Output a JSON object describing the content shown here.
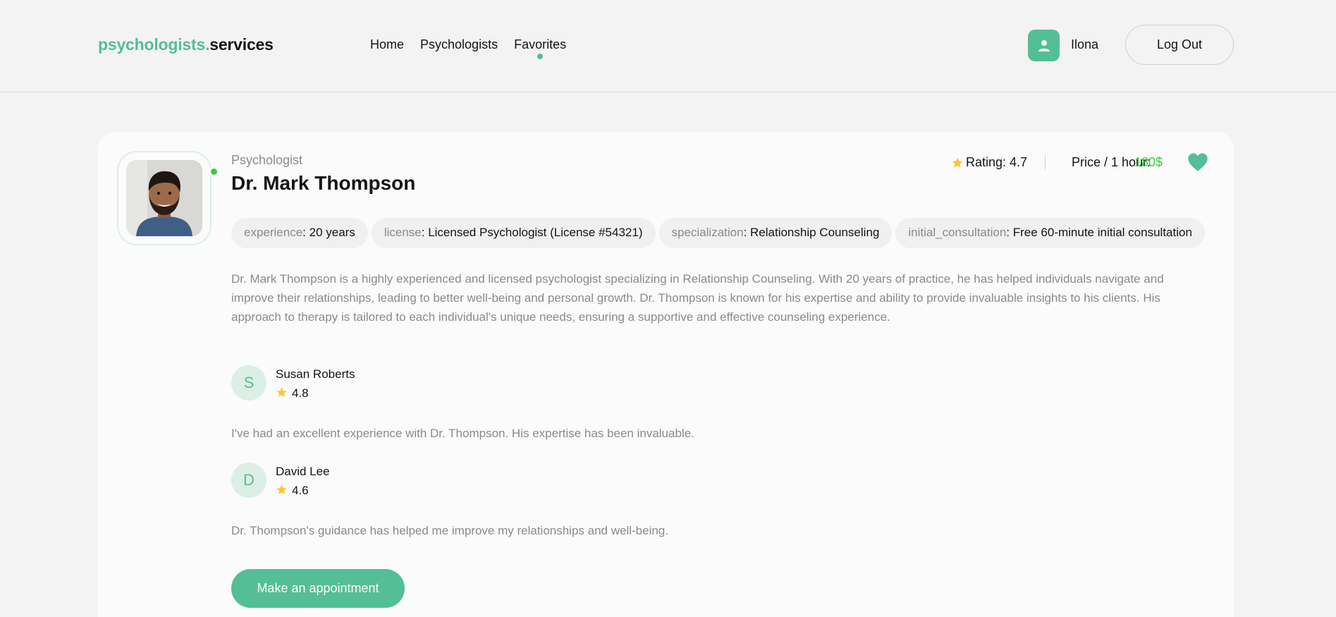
{
  "header": {
    "logo_accent": "psychologists.",
    "logo_rest": "services",
    "nav": [
      {
        "label": "Home",
        "active": false
      },
      {
        "label": "Psychologists",
        "active": false
      },
      {
        "label": "Favorites",
        "active": true
      }
    ],
    "user_icon": "user-icon",
    "user_name": "Ilona",
    "logout_label": "Log Out"
  },
  "profile": {
    "role": "Psychologist",
    "name": "Dr. Mark Thompson",
    "online": true,
    "rating_label": "Rating: 4.7",
    "price_label": "Price / 1 hour:",
    "price_value": "180$",
    "favorite": true,
    "tags": [
      {
        "key": "experience",
        "value": ": 20 years"
      },
      {
        "key": "license",
        "value": ": Licensed Psychologist (License #54321)"
      },
      {
        "key": "specialization",
        "value": ": Relationship Counseling"
      },
      {
        "key": "initial_consultation",
        "value": ": Free 60-minute initial consultation"
      }
    ],
    "description": "Dr. Mark Thompson is a highly experienced and licensed psychologist specializing in Relationship Counseling. With 20 years of practice, he has helped individuals navigate and improve their relationships, leading to better well-being and personal growth. Dr. Thompson is known for his expertise and ability to provide invaluable insights to his clients. His approach to therapy is tailored to each individual's unique needs, ensuring a supportive and effective counseling experience."
  },
  "reviews": [
    {
      "initial": "S",
      "name": "Susan Roberts",
      "rating": "4.8",
      "text": "I've had an excellent experience with Dr. Thompson. His expertise has been invaluable."
    },
    {
      "initial": "D",
      "name": "David Lee",
      "rating": "4.6",
      "text": "Dr. Thompson's guidance has helped me improve my relationships and well-being."
    }
  ],
  "cta_label": "Make an appointment",
  "colors": {
    "accent": "#54be96",
    "online": "#38cd3e",
    "star": "#ffc531",
    "muted_text": "#8a8a89"
  }
}
